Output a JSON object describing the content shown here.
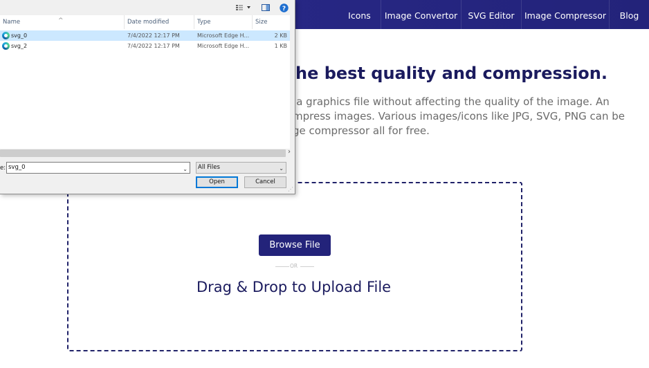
{
  "website": {
    "nav": {
      "items": [
        {
          "label": "Icons"
        },
        {
          "label": "Image Convertor"
        },
        {
          "label": "SVG Editor"
        },
        {
          "label": "Image Compressor"
        },
        {
          "label": "Blog"
        }
      ],
      "bg_color": "#23237a"
    },
    "hero": {
      "title": "he best quality and compression.",
      "desc_lines": [
        "of a graphics file without affecting the quality of the image. An",
        "mpress images. Various images/icons like JPG, SVG, PNG can be",
        "ge compressor all for free."
      ]
    },
    "upload": {
      "browse_label": "Browse File",
      "or_label": "OR",
      "drag_label": "Drag & Drop to Upload File"
    }
  },
  "dialog": {
    "toolbar": {
      "view_icon": "view-options-icon",
      "pane_icon": "preview-pane-icon",
      "help_icon": "help-icon"
    },
    "columns": {
      "name": "Name",
      "date": "Date modified",
      "type": "Type",
      "size": "Size"
    },
    "files": [
      {
        "name": "svg_0",
        "date": "7/4/2022 12:17 PM",
        "type": "Microsoft Edge H...",
        "size": "2 KB",
        "selected": true
      },
      {
        "name": "svg_2",
        "date": "7/4/2022 12:17 PM",
        "type": "Microsoft Edge H...",
        "size": "1 KB",
        "selected": false
      }
    ],
    "filename_label": "e:",
    "filename_value": "svg_0",
    "filter_value": "All Files",
    "open_label": "Open",
    "cancel_label": "Cancel"
  }
}
